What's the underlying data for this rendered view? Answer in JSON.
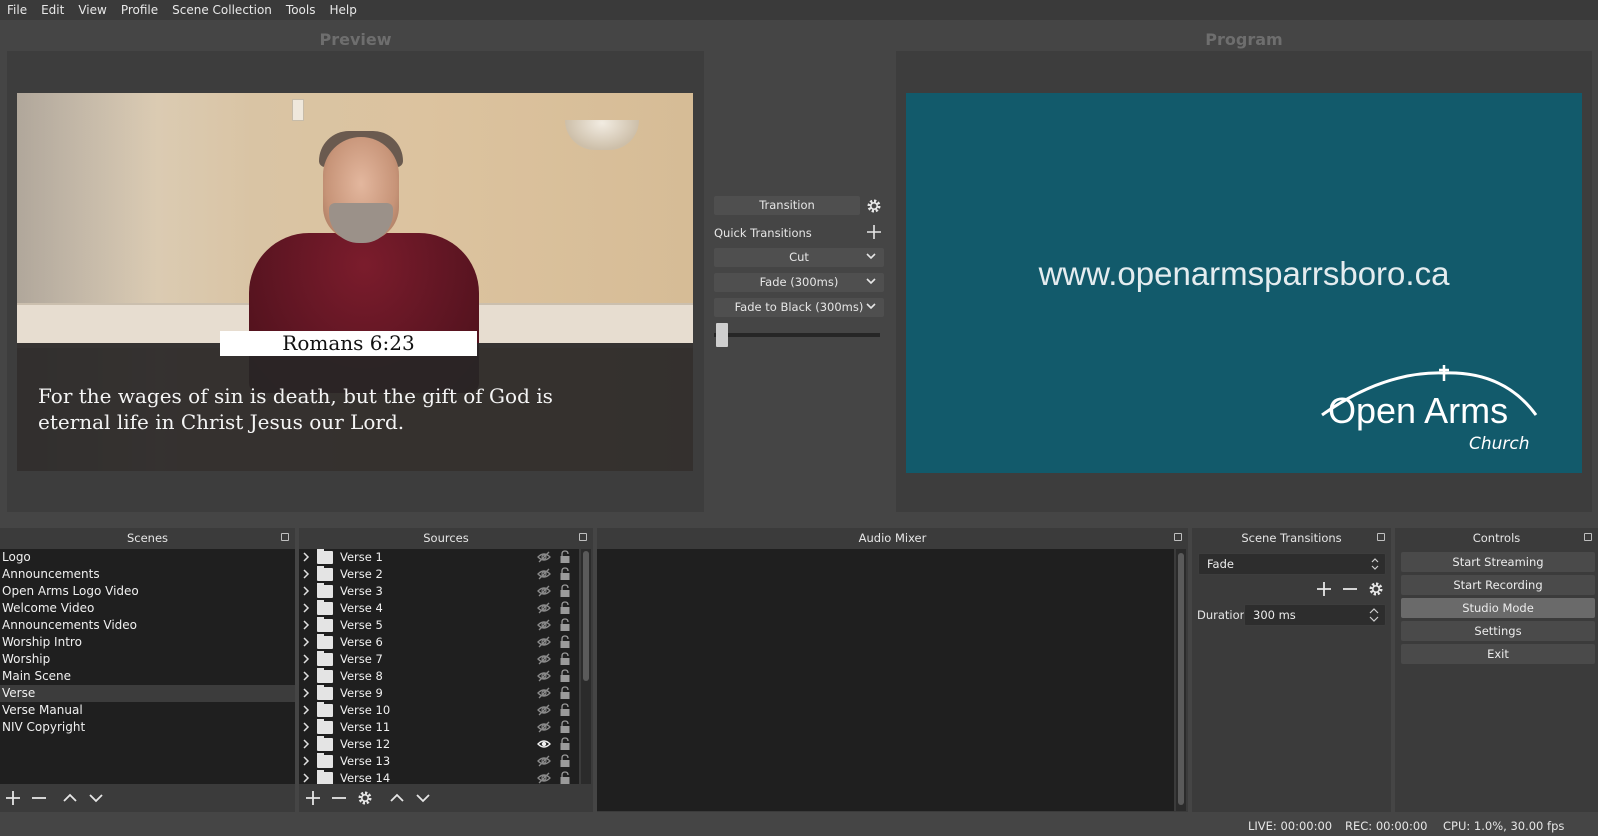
{
  "menu": [
    "File",
    "Edit",
    "View",
    "Profile",
    "Scene Collection",
    "Tools",
    "Help"
  ],
  "preview": {
    "label": "Preview",
    "verse_reference": "Romans 6:23",
    "verse_line1": "For the wages of sin is death, but the gift of God is",
    "verse_line2": "eternal life in Christ Jesus our Lord."
  },
  "program": {
    "label": "Program",
    "url_text": "www.openarmsparrsboro.ca",
    "logo_title": "Open Arms",
    "logo_subtitle": "Church"
  },
  "transition_panel": {
    "transition_button": "Transition",
    "quick_transitions_label": "Quick Transitions",
    "quick_items": [
      "Cut",
      "Fade (300ms)",
      "Fade to Black (300ms)"
    ],
    "tbar_position": 0
  },
  "scenes": {
    "title": "Scenes",
    "items": [
      "Logo",
      "Announcements",
      "Open Arms Logo Video",
      "Welcome Video",
      "Announcements Video",
      "Worship Intro",
      "Worship",
      "Main Scene",
      "Verse",
      "Verse Manual",
      "NIV Copyright"
    ],
    "selected_index": 8
  },
  "sources": {
    "title": "Sources",
    "items": [
      {
        "name": "Verse 1",
        "visible": false
      },
      {
        "name": "Verse 2",
        "visible": false
      },
      {
        "name": "Verse 3",
        "visible": false
      },
      {
        "name": "Verse 4",
        "visible": false
      },
      {
        "name": "Verse 5",
        "visible": false
      },
      {
        "name": "Verse 6",
        "visible": false
      },
      {
        "name": "Verse 7",
        "visible": false
      },
      {
        "name": "Verse 8",
        "visible": false
      },
      {
        "name": "Verse 9",
        "visible": false
      },
      {
        "name": "Verse 10",
        "visible": false
      },
      {
        "name": "Verse 11",
        "visible": false
      },
      {
        "name": "Verse 12",
        "visible": true
      },
      {
        "name": "Verse 13",
        "visible": false
      },
      {
        "name": "Verse 14",
        "visible": false
      }
    ]
  },
  "audio_mixer": {
    "title": "Audio Mixer"
  },
  "scene_transitions": {
    "title": "Scene Transitions",
    "selected": "Fade",
    "duration_label": "Duration",
    "duration_value": "300 ms"
  },
  "controls": {
    "title": "Controls",
    "buttons": [
      "Start Streaming",
      "Start Recording",
      "Studio Mode",
      "Settings",
      "Exit"
    ],
    "active_index": 2
  },
  "status": {
    "live": "LIVE: 00:00:00",
    "rec": "REC: 00:00:00",
    "cpu": "CPU: 1.0%, 30.00 fps"
  },
  "colors": {
    "program_bg": "#125a6b",
    "dock_bg": "#3b3b3b",
    "list_bg": "#1f1f1f"
  }
}
